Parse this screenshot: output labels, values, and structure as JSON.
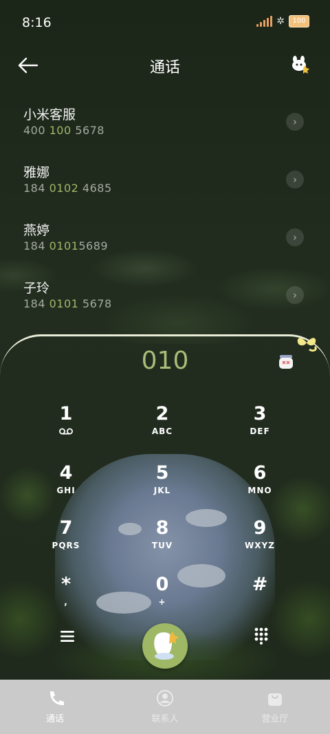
{
  "status_bar": {
    "time": "8:16",
    "battery": "100"
  },
  "header": {
    "title": "通话"
  },
  "recent_calls": [
    {
      "name": "小米客服",
      "number_prefix": "400 ",
      "number_match": "100",
      "number_suffix": " 5678"
    },
    {
      "name": "雅娜",
      "number_prefix": "184 ",
      "number_match": "0102",
      "number_suffix": " 4685"
    },
    {
      "name": "燕婷",
      "number_prefix": "184 ",
      "number_match": "0101",
      "number_suffix": "5689"
    },
    {
      "name": "子玲",
      "number_prefix": "184 ",
      "number_match": "0101",
      "number_suffix": " 5678"
    }
  ],
  "dialer": {
    "entry": "010",
    "keys": [
      {
        "digit": "1",
        "letters": ""
      },
      {
        "digit": "2",
        "letters": "ABC"
      },
      {
        "digit": "3",
        "letters": "DEF"
      },
      {
        "digit": "4",
        "letters": "GHI"
      },
      {
        "digit": "5",
        "letters": "JKL"
      },
      {
        "digit": "6",
        "letters": "MNO"
      },
      {
        "digit": "7",
        "letters": "PQRS"
      },
      {
        "digit": "8",
        "letters": "TUV"
      },
      {
        "digit": "9",
        "letters": "WXYZ"
      },
      {
        "digit": "*",
        "letters": ","
      },
      {
        "digit": "0",
        "letters": "+"
      },
      {
        "digit": "#",
        "letters": ""
      }
    ]
  },
  "bottom_nav": {
    "calls": "通话",
    "contacts": "联系人",
    "service_hall": "营业厅"
  },
  "colors": {
    "accent": "#9fb866",
    "highlight_digits": "#9fb86a",
    "nav_bg": "#cacaca"
  }
}
